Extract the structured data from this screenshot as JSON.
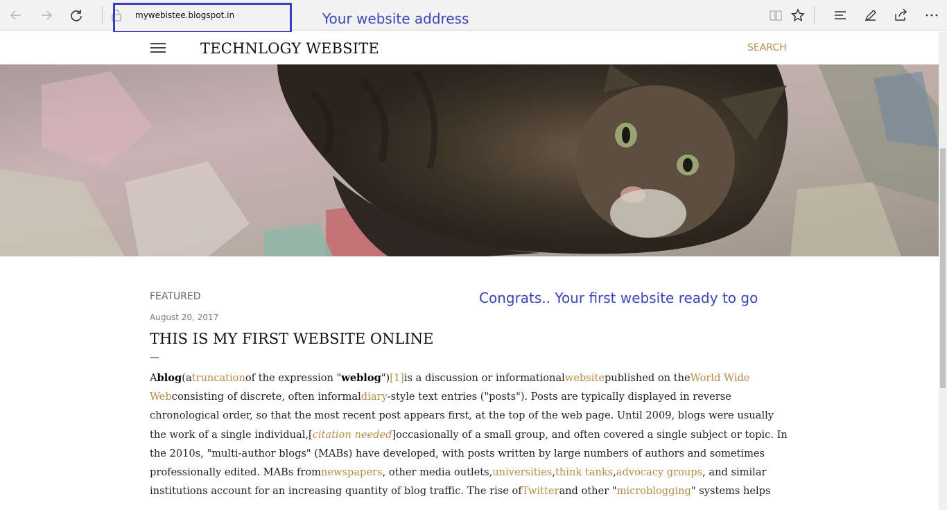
{
  "browser": {
    "address": "mywebistee.blogspot.in",
    "icons": [
      "back-icon",
      "forward-icon",
      "refresh-icon",
      "lock-icon",
      "reading-view-icon",
      "favorite-star-icon",
      "hub-icon",
      "web-note-icon",
      "share-icon",
      "more-icon"
    ]
  },
  "annotations": {
    "address_callout": "Your website address",
    "ready_callout": "Congrats.. Your first website ready to go",
    "highlight_color": "#3a3dc2"
  },
  "site": {
    "title": "TECHNLOGY WEBSITE",
    "search_label": "SEARCH",
    "accent_color": "#b58c47"
  },
  "post": {
    "label": "FEATURED",
    "date": "August 20, 2017",
    "title": "THIS IS MY FIRST WEBSITE ONLINE",
    "dash": "—",
    "body": [
      {
        "t": "A"
      },
      {
        "t": "blog",
        "b": true
      },
      {
        "t": "("
      },
      {
        "t": "a"
      },
      {
        "t": "truncation",
        "l": true
      },
      {
        "t": "of the expression \""
      },
      {
        "t": "weblog",
        "b": true
      },
      {
        "t": "\")"
      },
      {
        "t": "[1]",
        "l": true
      },
      {
        "t": "is a discussion or informational"
      },
      {
        "t": "website",
        "l": true
      },
      {
        "t": "published on the"
      },
      {
        "t": "World Wide Web",
        "l": true
      },
      {
        "t": "consisting of discrete, often informal"
      },
      {
        "t": "diary",
        "l": true
      },
      {
        "t": "-style text entries (\"posts\"). Posts are typically displayed in reverse chronological order, so that the most recent post appears first, at the top of the web page. Until 2009, blogs were usually the work of a single individual,["
      },
      {
        "t": "citation needed",
        "l": true,
        "i": true
      },
      {
        "t": "]occasionally of a small group, and often covered a single subject or topic. In the 2010s, \"multi-author blogs\" (MABs) have developed, with posts written by large numbers of authors and sometimes professionally edited. MABs from"
      },
      {
        "t": "newspapers",
        "l": true
      },
      {
        "t": ", other media outlets,"
      },
      {
        "t": "universities",
        "l": true
      },
      {
        "t": ","
      },
      {
        "t": "think tanks",
        "l": true
      },
      {
        "t": ","
      },
      {
        "t": "advocacy groups",
        "l": true
      },
      {
        "t": ", and similar institutions account for an increasing quantity of blog traffic. The rise of"
      },
      {
        "t": "Twitter",
        "l": true
      },
      {
        "t": "and other \""
      },
      {
        "t": "microblogging",
        "l": true
      },
      {
        "t": "\" systems helps"
      }
    ]
  }
}
